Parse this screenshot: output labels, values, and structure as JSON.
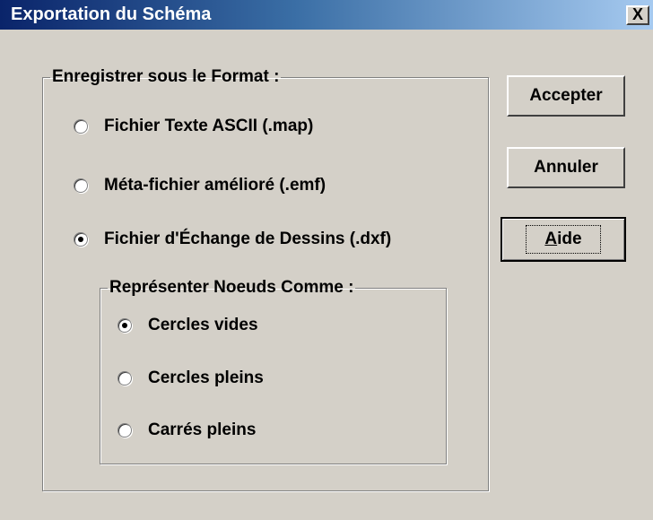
{
  "window": {
    "title": "Exportation du Schéma",
    "close_label": "X"
  },
  "format_group": {
    "legend": "Enregistrer sous le Format :",
    "options": [
      {
        "label": "Fichier Texte ASCII (.map)",
        "checked": false
      },
      {
        "label": "Méta-fichier amélioré (.emf)",
        "checked": false
      },
      {
        "label": "Fichier d'Échange de Dessins (.dxf)",
        "checked": true
      }
    ]
  },
  "nodes_group": {
    "legend": "Représenter Noeuds Comme :",
    "options": [
      {
        "label": "Cercles vides",
        "checked": true
      },
      {
        "label": "Cercles pleins",
        "checked": false
      },
      {
        "label": "Carrés pleins",
        "checked": false
      }
    ]
  },
  "buttons": {
    "accept": "Accepter",
    "cancel": "Annuler",
    "help_first": "A",
    "help_rest": "ide"
  }
}
